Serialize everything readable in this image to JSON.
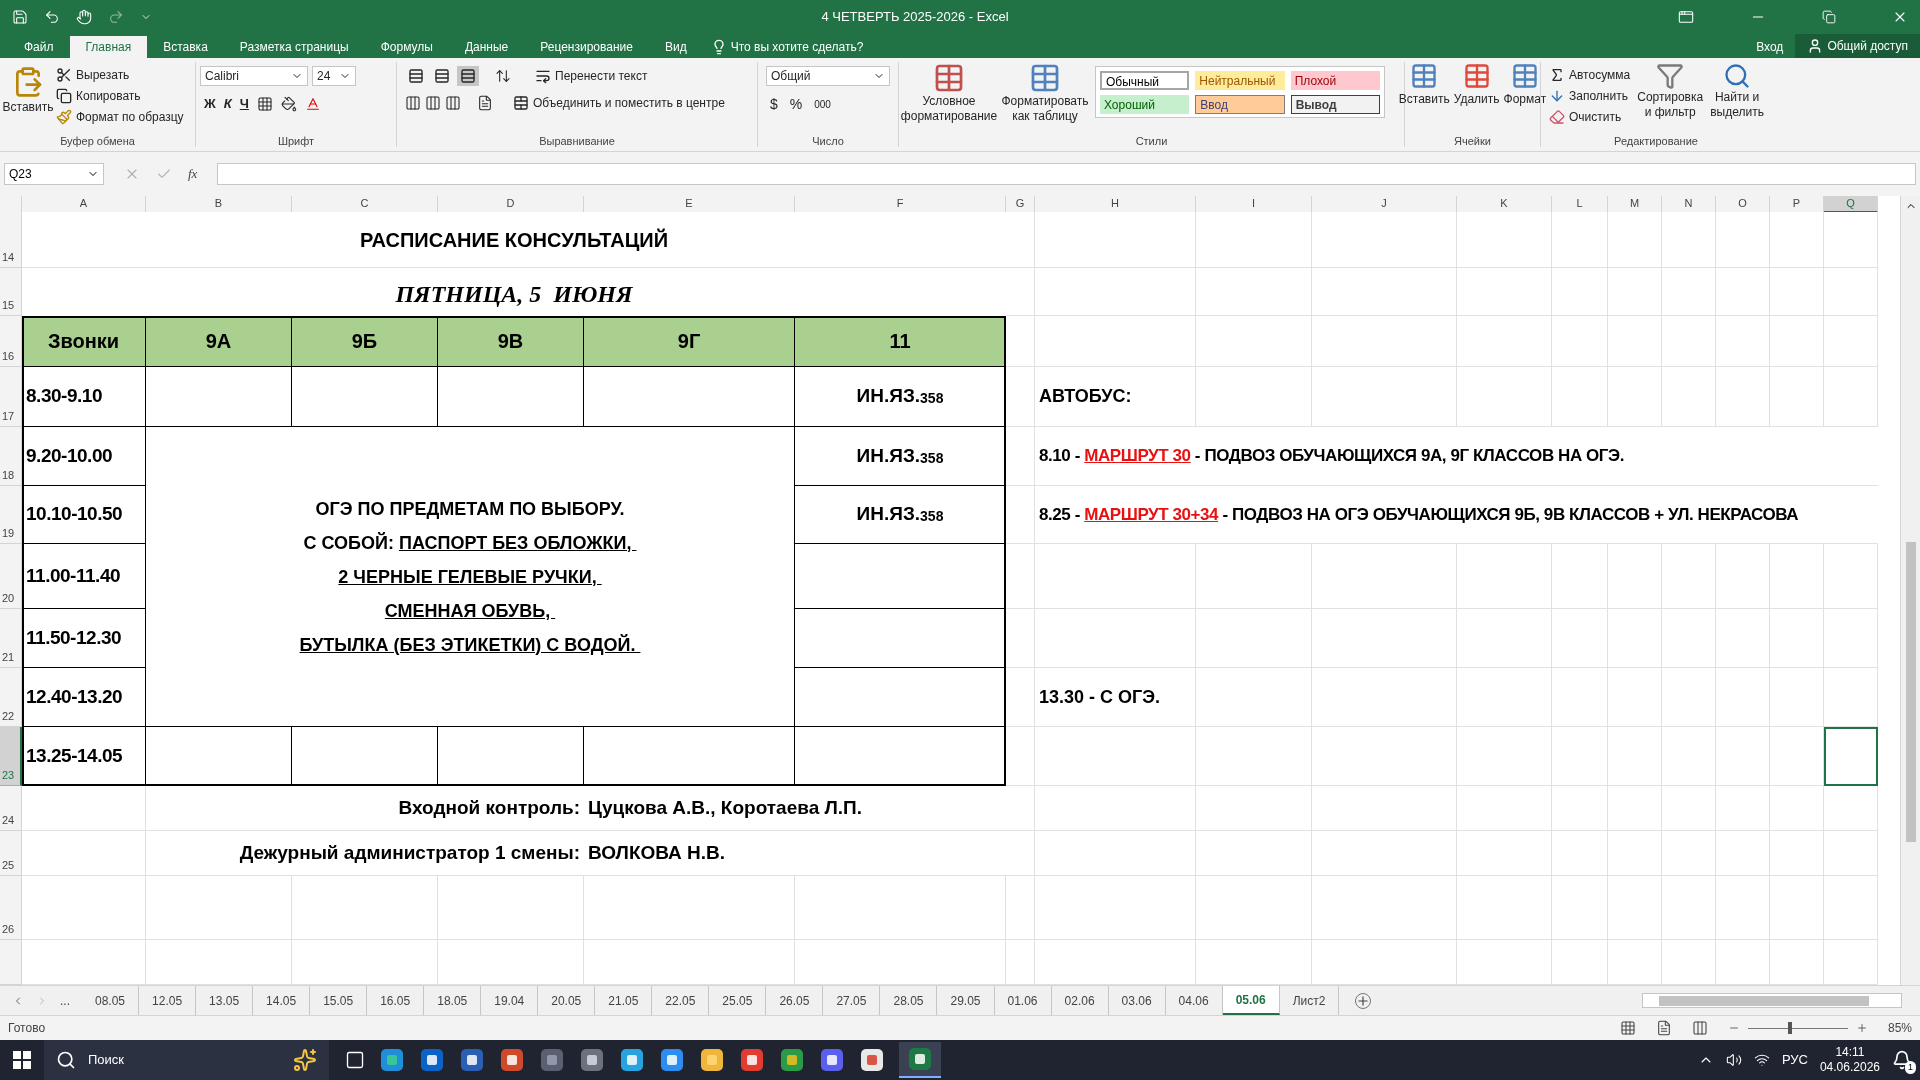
{
  "window": {
    "title": "4 ЧЕТВЕРТЬ 2025-2026 - Excel"
  },
  "menu_tabs": [
    {
      "label": "Файл",
      "selected": false
    },
    {
      "label": "Главная",
      "selected": true
    },
    {
      "label": "Вставка",
      "selected": false
    },
    {
      "label": "Разметка страницы",
      "selected": false
    },
    {
      "label": "Формулы",
      "selected": false
    },
    {
      "label": "Данные",
      "selected": false
    },
    {
      "label": "Рецензирование",
      "selected": false
    },
    {
      "label": "Вид",
      "selected": false
    }
  ],
  "tell_me": "Что вы хотите сделать?",
  "account": {
    "sign_in": "Вход",
    "share": "Общий доступ"
  },
  "ribbon": {
    "clipboard": {
      "paste": "Вставить",
      "cut": "Вырезать",
      "copy": "Копировать",
      "format_painter": "Формат по образцу",
      "label": "Буфер обмена"
    },
    "font": {
      "name": "Calibri",
      "size": "24",
      "bold": "Ж",
      "italic": "К",
      "underline": "Ч",
      "label": "Шрифт"
    },
    "alignment": {
      "vertical_align": [
        {
          "selected": false
        },
        {
          "selected": false
        },
        {
          "selected": true
        }
      ],
      "wrap": "Перенести текст",
      "merge": "Объединить и поместить в центре",
      "label": "Выравнивание"
    },
    "number": {
      "format": "Общий",
      "currency": "$",
      "percent": "%",
      "thousands": "000",
      "label": "Число"
    },
    "styles": {
      "conditional": "Условное форматирование",
      "format_table": "Форматировать как таблицу",
      "cell_styles": [
        {
          "label": "Обычный",
          "kind": "normal"
        },
        {
          "label": "Нейтральный",
          "kind": "neutral"
        },
        {
          "label": "Плохой",
          "kind": "bad"
        },
        {
          "label": "Хороший",
          "kind": "good"
        },
        {
          "label": "Ввод",
          "kind": "input"
        },
        {
          "label": "Вывод",
          "kind": "output"
        }
      ],
      "label": "Стили"
    },
    "cells": {
      "insert": "Вставить",
      "delete": "Удалить",
      "format": "Формат",
      "label": "Ячейки"
    },
    "editing": {
      "autosum": "Автосумма",
      "fill": "Заполнить",
      "clear": "Очистить",
      "sort": "Сортировка и фильтр",
      "find": "Найти и выделить",
      "label": "Редактирование"
    }
  },
  "formula_bar": {
    "name_box": "Q23",
    "function_label": "fx"
  },
  "columns": [
    {
      "label": "A",
      "selected": false
    },
    {
      "label": "B",
      "selected": false
    },
    {
      "label": "C",
      "selected": false
    },
    {
      "label": "D",
      "selected": false
    },
    {
      "label": "E",
      "selected": false
    },
    {
      "label": "F",
      "selected": false
    },
    {
      "label": "G",
      "selected": false
    },
    {
      "label": "H",
      "selected": false
    },
    {
      "label": "I",
      "selected": false
    },
    {
      "label": "J",
      "selected": false
    },
    {
      "label": "K",
      "selected": false
    },
    {
      "label": "L",
      "selected": false
    },
    {
      "label": "M",
      "selected": false
    },
    {
      "label": "N",
      "selected": false
    },
    {
      "label": "O",
      "selected": false
    },
    {
      "label": "P",
      "selected": false
    },
    {
      "label": "Q",
      "selected": true
    }
  ],
  "rows": [
    {
      "label": "14",
      "selected": false
    },
    {
      "label": "15",
      "selected": false
    },
    {
      "label": "16",
      "selected": false
    },
    {
      "label": "17",
      "selected": false
    },
    {
      "label": "18",
      "selected": false
    },
    {
      "label": "19",
      "selected": false
    },
    {
      "label": "20",
      "selected": false
    },
    {
      "label": "21",
      "selected": false
    },
    {
      "label": "22",
      "selected": false
    },
    {
      "label": "23",
      "selected": true
    },
    {
      "label": "24",
      "selected": false
    },
    {
      "label": "25",
      "selected": false
    },
    {
      "label": "26",
      "selected": false
    }
  ],
  "schedule": {
    "title": "РАСПИСАНИЕ КОНСУЛЬТАЦИЙ",
    "date": "ПЯТНИЦА, 5  ИЮНЯ",
    "headers": [
      "Звонки",
      "9А",
      "9Б",
      "9В",
      "9Г",
      "11"
    ],
    "times": [
      "8.30-9.10",
      "9.20-10.00",
      "10.10-10.50",
      "11.00-11.40",
      "11.50-12.30",
      "12.40-13.20",
      "13.25-14.05"
    ],
    "grade11": [
      {
        "subject": "ИН.ЯЗ.",
        "room": "358"
      },
      {
        "subject": "ИН.ЯЗ.",
        "room": "358"
      },
      {
        "subject": "ИН.ЯЗ.",
        "room": "358"
      }
    ],
    "notice": [
      [
        {
          "text": "ОГЭ ПО ПРЕДМЕТАМ ПО ВЫБОРУ.",
          "underline": false
        }
      ],
      [
        {
          "text": "С СОБОЙ: ",
          "underline": false
        },
        {
          "text": "ПАСПОРТ БЕЗ ОБЛОЖКИ, ",
          "underline": true
        }
      ],
      [
        {
          "text": "2 ЧЕРНЫЕ ГЕЛЕВЫЕ РУЧКИ, ",
          "underline": true
        }
      ],
      [
        {
          "text": "СМЕННАЯ ОБУВЬ, ",
          "underline": true
        }
      ],
      [
        {
          "text": "БУТЫЛКА (БЕЗ ЭТИКЕТКИ) С ВОДОЙ. ",
          "underline": true
        }
      ]
    ],
    "staff": [
      {
        "label": "Входной контроль:",
        "value": "Цуцкова А.В., Коротаева Л.П."
      },
      {
        "label": "Дежурный администратор 1 смены:",
        "value": "ВОЛКОВА Н.В."
      }
    ]
  },
  "bus": {
    "heading": "АВТОБУС:",
    "trips": [
      [
        {
          "text": "8.10 - ",
          "highlight": false
        },
        {
          "text": "МАРШРУТ 30",
          "highlight": true
        },
        {
          "text": " - ПОДВОЗ ОБУЧАЮЩИХСЯ 9А, 9Г КЛАССОВ НА ОГЭ.",
          "highlight": false
        }
      ],
      [
        {
          "text": "8.25 - ",
          "highlight": false
        },
        {
          "text": "МАРШРУТ 30+34",
          "highlight": true
        },
        {
          "text": " - ПОДВОЗ НА ОГЭ ОБУЧАЮЩИХСЯ 9Б, 9В КЛАССОВ + УЛ. НЕКРАСОВА",
          "highlight": false
        }
      ]
    ],
    "return": "13.30 - С ОГЭ."
  },
  "sheet_tabs_more": "...",
  "sheet_tabs": [
    {
      "label": "08.05",
      "selected": false
    },
    {
      "label": "12.05",
      "selected": false
    },
    {
      "label": "13.05",
      "selected": false
    },
    {
      "label": "14.05",
      "selected": false
    },
    {
      "label": "15.05",
      "selected": false
    },
    {
      "label": "16.05",
      "selected": false
    },
    {
      "label": "18.05",
      "selected": false
    },
    {
      "label": "19.04",
      "selected": false
    },
    {
      "label": "20.05",
      "selected": false
    },
    {
      "label": "21.05",
      "selected": false
    },
    {
      "label": "22.05",
      "selected": false
    },
    {
      "label": "25.05",
      "selected": false
    },
    {
      "label": "26.05",
      "selected": false
    },
    {
      "label": "27.05",
      "selected": false
    },
    {
      "label": "28.05",
      "selected": false
    },
    {
      "label": "29.05",
      "selected": false
    },
    {
      "label": "01.06",
      "selected": false
    },
    {
      "label": "02.06",
      "selected": false
    },
    {
      "label": "03.06",
      "selected": false
    },
    {
      "label": "04.06",
      "selected": false
    },
    {
      "label": "05.06",
      "selected": true
    },
    {
      "label": "Лист2",
      "selected": false
    }
  ],
  "status": {
    "text": "Готово",
    "zoom": "85%",
    "zoom_slider": {
      "level": 0.4
    }
  },
  "taskbar": {
    "search": "Поиск",
    "language": "РУС",
    "time": "14:11",
    "date": "04.06.2026",
    "notifications": "1"
  }
}
